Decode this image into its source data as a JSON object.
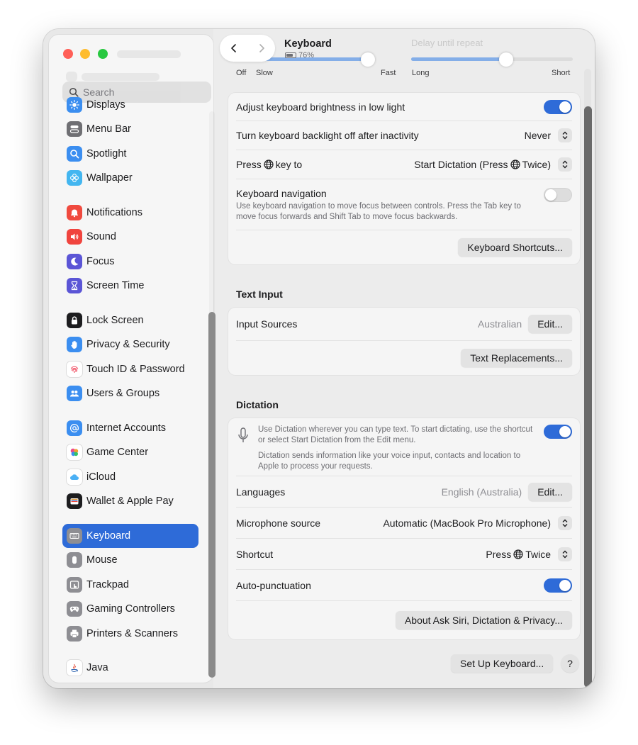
{
  "window": {
    "title": "Keyboard",
    "battery": "76%"
  },
  "search": {
    "placeholder": "Search"
  },
  "sidebar": {
    "items": [
      {
        "label": "Displays",
        "icon": "sun-icon",
        "color": "#3b8ef0"
      },
      {
        "label": "Menu Bar",
        "icon": "menubar-icon",
        "color": "#6f6f73"
      },
      {
        "label": "Spotlight",
        "icon": "magnifier-icon",
        "color": "#3b8ef0"
      },
      {
        "label": "Wallpaper",
        "icon": "flower-icon",
        "color": "#43b6f0"
      },
      {
        "label": "Notifications",
        "icon": "bell-icon",
        "color": "#f04a3f"
      },
      {
        "label": "Sound",
        "icon": "speaker-icon",
        "color": "#f0443e"
      },
      {
        "label": "Focus",
        "icon": "moon-icon",
        "color": "#5b55d6"
      },
      {
        "label": "Screen Time",
        "icon": "hourglass-icon",
        "color": "#5b55d6"
      },
      {
        "label": "Lock Screen",
        "icon": "lock-icon",
        "color": "#1d1d1f"
      },
      {
        "label": "Privacy & Security",
        "icon": "hand-icon",
        "color": "#3b8ef0"
      },
      {
        "label": "Touch ID & Password",
        "icon": "fingerprint-icon",
        "color": "#ffffff"
      },
      {
        "label": "Users & Groups",
        "icon": "users-icon",
        "color": "#3b8ef0"
      },
      {
        "label": "Internet Accounts",
        "icon": "at-icon",
        "color": "#3b8ef0"
      },
      {
        "label": "Game Center",
        "icon": "gamecenter-icon",
        "color": "#ffffff"
      },
      {
        "label": "iCloud",
        "icon": "cloud-icon",
        "color": "#ffffff"
      },
      {
        "label": "Wallet & Apple Pay",
        "icon": "wallet-icon",
        "color": "#1d1d1f"
      },
      {
        "label": "Keyboard",
        "icon": "keyboard-icon",
        "color": "#8e8e93"
      },
      {
        "label": "Mouse",
        "icon": "mouse-icon",
        "color": "#8e8e93"
      },
      {
        "label": "Trackpad",
        "icon": "trackpad-icon",
        "color": "#8e8e93"
      },
      {
        "label": "Gaming Controllers",
        "icon": "gamepad-icon",
        "color": "#8e8e93"
      },
      {
        "label": "Printers & Scanners",
        "icon": "printer-icon",
        "color": "#8e8e93"
      },
      {
        "label": "Java",
        "icon": "java-icon",
        "color": "#ffffff"
      }
    ],
    "selected": "Keyboard"
  },
  "sliders": {
    "key_repeat": {
      "labels": [
        "Off",
        "Slow",
        "Fast"
      ],
      "level": 0.88
    },
    "delay_until_repeat": {
      "ghost_label": "Delay until repeat",
      "labels": [
        "Long",
        "Short"
      ],
      "level": 0.6
    }
  },
  "keyboard": {
    "brightness_low_light": {
      "label": "Adjust keyboard brightness in low light",
      "on": true
    },
    "backlight_off": {
      "label": "Turn keyboard backlight off after inactivity",
      "value": "Never"
    },
    "press_key": {
      "label_before": "Press",
      "label_after": "key to",
      "value_before": "Start Dictation (Press",
      "value_after": "Twice)"
    },
    "navigation": {
      "label": "Keyboard navigation",
      "description": "Use keyboard navigation to move focus between controls. Press the Tab key to move focus forwards and Shift Tab to move focus backwards.",
      "on": false
    },
    "shortcuts_button": "Keyboard Shortcuts..."
  },
  "text_input": {
    "title": "Text Input",
    "input_sources": {
      "label": "Input Sources",
      "value": "Australian",
      "button": "Edit..."
    },
    "replacements_button": "Text Replacements..."
  },
  "dictation": {
    "title": "Dictation",
    "desc1": "Use Dictation wherever you can type text. To start dictating, use the shortcut or select Start Dictation from the Edit menu.",
    "desc2": "Dictation sends information like your voice input, contacts and location to Apple to process your requests.",
    "on": true,
    "languages": {
      "label": "Languages",
      "value": "English (Australia)",
      "button": "Edit..."
    },
    "microphone": {
      "label": "Microphone source",
      "value": "Automatic (MacBook Pro Microphone)"
    },
    "shortcut": {
      "label": "Shortcut",
      "value_before": "Press",
      "value_after": "Twice"
    },
    "auto_punct": {
      "label": "Auto-punctuation",
      "on": true
    },
    "about_button": "About Ask Siri, Dictation & Privacy..."
  },
  "footer": {
    "setup_button": "Set Up Keyboard...",
    "help": "?"
  }
}
